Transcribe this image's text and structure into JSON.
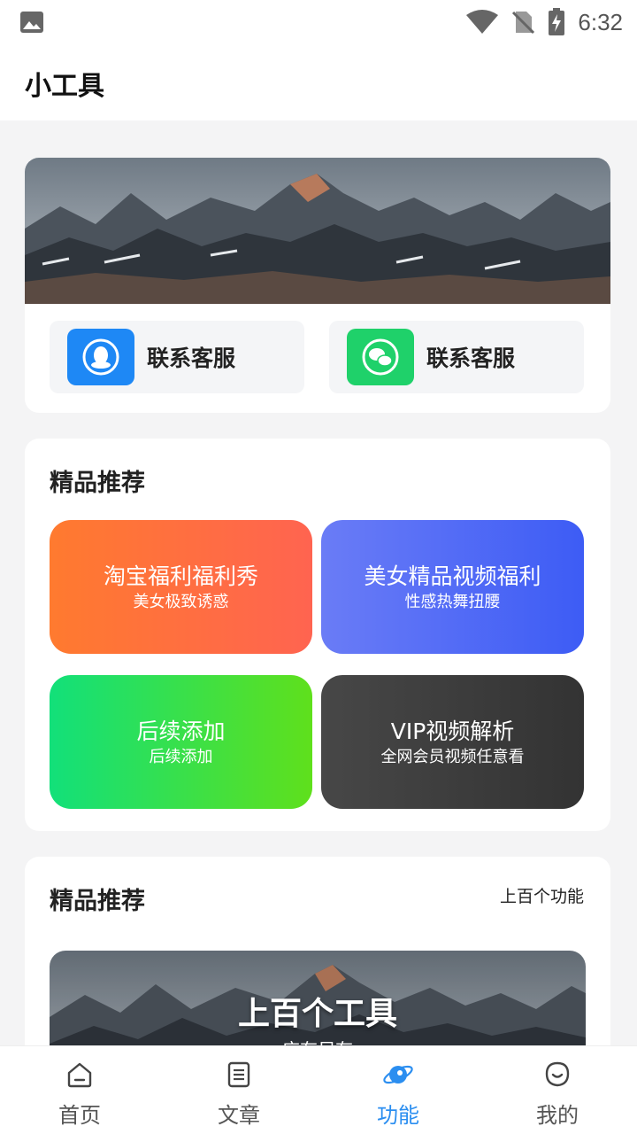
{
  "status": {
    "time": "6:32"
  },
  "app": {
    "title": "小工具"
  },
  "contacts": [
    {
      "label": "联系客服",
      "icon": "qq-icon",
      "color": "#1e88f5"
    },
    {
      "label": "联系客服",
      "icon": "wechat-icon",
      "color": "#1fd16a"
    }
  ],
  "recommend": {
    "title": "精品推荐",
    "tiles": [
      {
        "title": "淘宝福利福利秀",
        "sub": "美女极致诱惑"
      },
      {
        "title": "美女精品视频福利",
        "sub": "性感热舞扭腰"
      },
      {
        "title": "后续添加",
        "sub": "后续添加"
      },
      {
        "title": "VIP视频解析",
        "sub": "全网会员视频任意看"
      }
    ]
  },
  "recommend2": {
    "title": "精品推荐",
    "more": "上百个功能",
    "banner_title": "上百个工具",
    "banner_sub": "应有尽有"
  },
  "tabs": [
    {
      "label": "首页",
      "icon": "home-icon"
    },
    {
      "label": "文章",
      "icon": "article-icon"
    },
    {
      "label": "功能",
      "icon": "planet-icon",
      "active": true
    },
    {
      "label": "我的",
      "icon": "profile-icon"
    }
  ]
}
